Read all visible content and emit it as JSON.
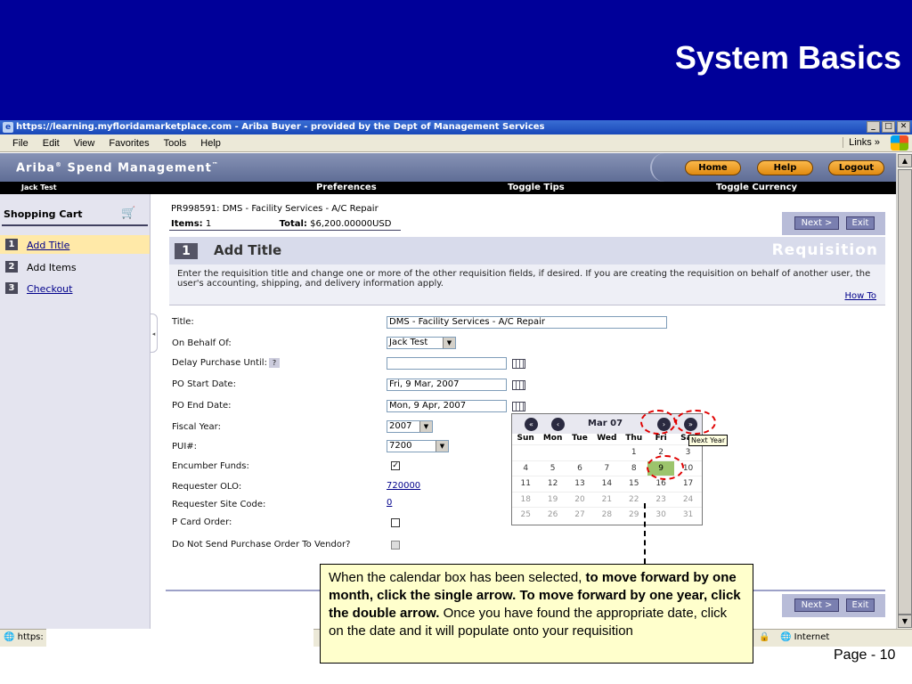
{
  "slide": {
    "title": "System Basics",
    "page_label": "Page - 10"
  },
  "browser": {
    "window_title": "https://learning.myfloridamarketplace.com - Ariba Buyer - provided by the Dept of Management Services",
    "window_buttons": [
      "_",
      "□",
      "✕"
    ],
    "menus": [
      "File",
      "Edit",
      "View",
      "Favorites",
      "Tools",
      "Help"
    ],
    "links_label": "Links",
    "status_left": "https:",
    "status_right": "Internet"
  },
  "ariba": {
    "logo": "Ariba",
    "logo_mark": "®",
    "logo_product": "Spend Management",
    "logo_tm": "™",
    "buttons": {
      "home": "Home",
      "help": "Help",
      "logout": "Logout"
    },
    "user": "Jack Test",
    "nav": {
      "preferences": "Preferences",
      "toggle_tips": "Toggle Tips",
      "toggle_currency": "Toggle Currency"
    }
  },
  "sidebar": {
    "title": "Shopping Cart",
    "steps": [
      {
        "num": "1",
        "label": "Add Title"
      },
      {
        "num": "2",
        "label": "Add Items"
      },
      {
        "num": "3",
        "label": "Checkout"
      }
    ]
  },
  "main": {
    "req_id": "PR998591: DMS - Facility Services - A/C Repair",
    "items_label": "Items:",
    "items_value": "1",
    "total_label": "Total:",
    "total_value": "$6,200.00000USD",
    "next_button": "Next >",
    "exit_button": "Exit",
    "step_num": "1",
    "step_title": "Add Title",
    "section_label": "Requisition",
    "instructions": "Enter the requisition title and change one or more of the other requisition fields, if desired. If you are creating the requisition on behalf of another user, the user's accounting, shipping, and delivery information apply.",
    "how_to": "How To",
    "fields": {
      "title": {
        "label": "Title:",
        "value": "DMS - Facility Services - A/C Repair"
      },
      "on_behalf": {
        "label": "On Behalf Of:",
        "value": "Jack Test"
      },
      "delay": {
        "label": "Delay Purchase Until:",
        "help": "?",
        "value": ""
      },
      "po_start": {
        "label": "PO Start Date:",
        "value": "Fri, 9 Mar, 2007"
      },
      "po_end": {
        "label": "PO End Date:",
        "value": "Mon, 9 Apr, 2007"
      },
      "fiscal_year": {
        "label": "Fiscal Year:",
        "value": "2007"
      },
      "pui": {
        "label": "PUI#:",
        "value": "7200"
      },
      "encumber": {
        "label": "Encumber Funds:",
        "checked": true
      },
      "requester_olo": {
        "label": "Requester OLO:",
        "value": "720000"
      },
      "site_code": {
        "label": "Requester Site Code:",
        "value": "0"
      },
      "pcard": {
        "label": "P Card Order:",
        "checked": false
      },
      "do_not_send": {
        "label": "Do Not Send Purchase Order To Vendor?",
        "checked": false
      }
    }
  },
  "calendar": {
    "month": "Mar 07",
    "prev_year": "«",
    "prev_month": "‹",
    "next_month": "›",
    "next_year": "»",
    "dow": [
      "Sun",
      "Mon",
      "Tue",
      "Wed",
      "Thu",
      "Fri",
      "Sat"
    ],
    "weeks": [
      [
        "",
        "",
        "",
        "",
        "1",
        "2",
        "3"
      ],
      [
        "4",
        "5",
        "6",
        "7",
        "8",
        "9",
        "10"
      ],
      [
        "11",
        "12",
        "13",
        "14",
        "15",
        "16",
        "17"
      ],
      [
        "18",
        "19",
        "20",
        "21",
        "22",
        "23",
        "24"
      ],
      [
        "25",
        "26",
        "27",
        "28",
        "29",
        "30",
        "31"
      ]
    ],
    "selected": "9",
    "tooltip": "Next Year"
  },
  "callout": {
    "part1": "When the calendar box has been selected, ",
    "part2_bold": "to move forward by one month, click the single arrow.  To move forward by one year, click the double arrow.",
    "part3": "  Once you have found the appropriate date, click on the date and it will populate onto your requisition"
  }
}
